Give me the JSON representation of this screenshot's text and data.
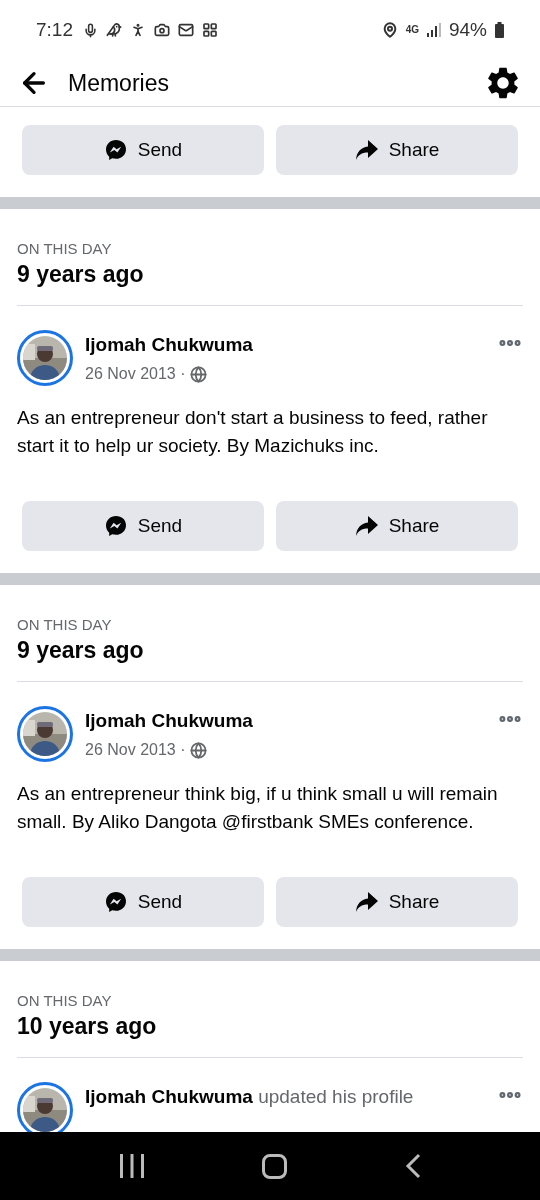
{
  "status_bar": {
    "time": "7:12",
    "network": "4G",
    "battery": "94%"
  },
  "header": {
    "title": "Memories"
  },
  "top_actions": [
    "Send",
    "Share"
  ],
  "memories": [
    {
      "label": "ON THIS DAY",
      "age": "9 years ago",
      "post": {
        "author": "Ijomah Chukwuma",
        "date": "26 Nov 2013",
        "separator": "·",
        "text": "As an entrepreneur don't start a business to feed, rather start it to help ur society. By Mazichuks inc."
      },
      "actions": [
        "Send",
        "Share"
      ]
    },
    {
      "label": "ON THIS DAY",
      "age": "9 years ago",
      "post": {
        "author": "Ijomah Chukwuma",
        "date": "26 Nov 2013",
        "separator": "·",
        "text": "As an entrepreneur think big, if u think small u will remain small. By Aliko Dangota @firstbank SMEs conference."
      },
      "actions": [
        "Send",
        "Share"
      ]
    },
    {
      "label": "ON THIS DAY",
      "age": "10 years ago",
      "post": {
        "author": "Ijomah Chukwuma",
        "activity": "updated his profile"
      }
    }
  ]
}
